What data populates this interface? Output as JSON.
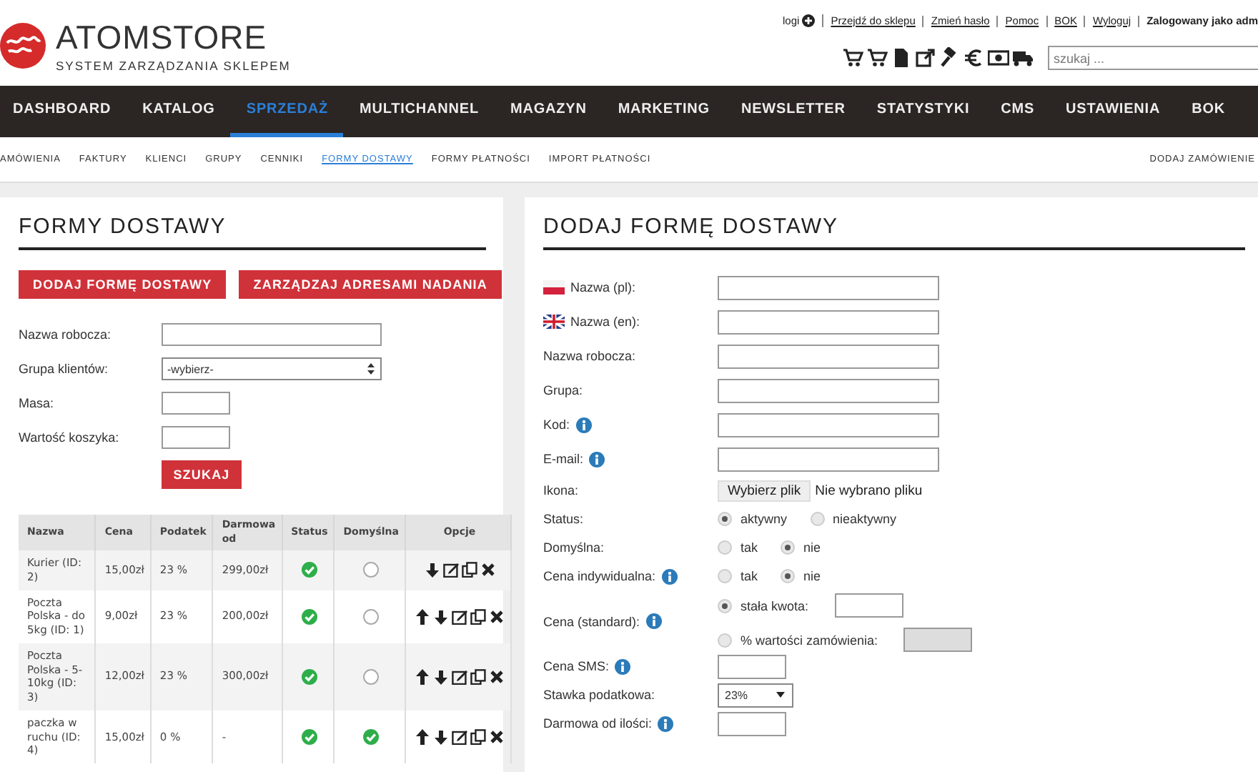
{
  "header": {
    "logo": {
      "name": "ATOMSTORE",
      "tagline": "SYSTEM ZARZĄDZANIA SKLEPEM"
    },
    "top_links": [
      {
        "label": "logi",
        "kind": "plus"
      },
      {
        "label": "Przejdź do sklepu",
        "kind": "link"
      },
      {
        "label": "Zmień hasło",
        "kind": "link"
      },
      {
        "label": "Pomoc",
        "kind": "link"
      },
      {
        "label": "BOK",
        "kind": "link"
      },
      {
        "label": "Wyloguj",
        "kind": "link"
      }
    ],
    "logged_in": "Zalogowany jako adm",
    "search": {
      "placeholder": "szukaj ..."
    }
  },
  "main_nav": [
    {
      "label": "DASHBOARD",
      "selected": false
    },
    {
      "label": "KATALOG",
      "selected": false
    },
    {
      "label": "SPRZEDAŻ",
      "selected": true
    },
    {
      "label": "MULTICHANNEL",
      "selected": false
    },
    {
      "label": "MAGAZYN",
      "selected": false
    },
    {
      "label": "MARKETING",
      "selected": false
    },
    {
      "label": "NEWSLETTER",
      "selected": false
    },
    {
      "label": "STATYSTYKI",
      "selected": false
    },
    {
      "label": "CMS",
      "selected": false
    },
    {
      "label": "USTAWIENIA",
      "selected": false
    },
    {
      "label": "BOK",
      "selected": false
    }
  ],
  "sub_nav": {
    "items": [
      {
        "label": "AMÓWIENIA",
        "selected": false
      },
      {
        "label": "FAKTURY",
        "selected": false
      },
      {
        "label": "KLIENCI",
        "selected": false
      },
      {
        "label": "GRUPY",
        "selected": false
      },
      {
        "label": "CENNIKI",
        "selected": false
      },
      {
        "label": "FORMY DOSTAWY",
        "selected": true
      },
      {
        "label": "FORMY PŁATNOŚCI",
        "selected": false
      },
      {
        "label": "IMPORT PŁATNOŚCI",
        "selected": false
      }
    ],
    "action": "DODAJ ZAMÓWIENIE"
  },
  "list_panel": {
    "title": "FORMY DOSTAWY",
    "buttons": [
      "DODAJ FORMĘ DOSTAWY",
      "ZARZĄDZAJ ADRESAMI NADANIA"
    ],
    "filters": [
      {
        "label": "Nazwa robocza:",
        "kind": "text"
      },
      {
        "label": "Grupa klientów:",
        "kind": "select",
        "value": "-wybierz-"
      },
      {
        "label": "Masa:",
        "kind": "short"
      },
      {
        "label": "Wartość koszyka:",
        "kind": "short"
      }
    ],
    "search_button": "SZUKAJ",
    "table": {
      "columns": [
        "Nazwa",
        "Cena",
        "Podatek",
        "Darmowa od",
        "Status",
        "Domyślna",
        "Opcje"
      ],
      "rows": [
        {
          "name": "Kurier (ID: 2)",
          "price": "15,00zł",
          "tax": "23 %",
          "free_from": "299,00zł",
          "status": true,
          "default": false,
          "can_move_up": false,
          "can_move_down": true
        },
        {
          "name": "Poczta Polska - do 5kg (ID: 1)",
          "price": "9,00zł",
          "tax": "23 %",
          "free_from": "200,00zł",
          "status": true,
          "default": false,
          "can_move_up": true,
          "can_move_down": true
        },
        {
          "name": "Poczta Polska - 5-10kg (ID: 3)",
          "price": "12,00zł",
          "tax": "23 %",
          "free_from": "300,00zł",
          "status": true,
          "default": false,
          "can_move_up": true,
          "can_move_down": true
        },
        {
          "name": "paczka w ruchu (ID: 4)",
          "price": "15,00zł",
          "tax": "0 %",
          "free_from": "-",
          "status": true,
          "default": true,
          "can_move_up": true,
          "can_move_down": true
        }
      ]
    }
  },
  "form_panel": {
    "title": "DODAJ FORMĘ DOSTAWY",
    "fields": [
      {
        "label": "Nazwa (pl):",
        "kind": "polish",
        "info": false
      },
      {
        "label": "Nazwa (en):",
        "kind": "english",
        "info": false
      },
      {
        "label": "Nazwa robocza:",
        "kind": "text",
        "info": false
      },
      {
        "label": "Grupa:",
        "kind": "text",
        "info": false
      },
      {
        "label": "Kod:",
        "kind": "text",
        "info": true
      },
      {
        "label": "E-mail:",
        "kind": "text",
        "info": true
      },
      {
        "label": "Ikona:",
        "kind": "file",
        "button": "Wybierz plik",
        "status": "Nie wybrano pliku",
        "info": false
      },
      {
        "label": "Status:",
        "kind": "radio",
        "info": false,
        "options": [
          {
            "label": "aktywny",
            "selected": true
          },
          {
            "label": "nieaktywny",
            "selected": false
          }
        ]
      },
      {
        "label": "Domyślna:",
        "kind": "radio",
        "info": false,
        "options": [
          {
            "label": "tak",
            "selected": false
          },
          {
            "label": "nie",
            "selected": true
          }
        ]
      },
      {
        "label": "Cena indywidualna:",
        "kind": "radio",
        "info": true,
        "options": [
          {
            "label": "tak",
            "selected": false
          },
          {
            "label": "nie",
            "selected": true
          }
        ]
      },
      {
        "label": "Cena (standard):",
        "kind": "price",
        "info": true,
        "options": [
          {
            "label": "stała kwota:",
            "selected": true,
            "disabled": false
          },
          {
            "label": "% wartości zamówienia:",
            "selected": false,
            "disabled": true
          }
        ]
      },
      {
        "label": "Cena SMS:",
        "kind": "short",
        "info": true
      },
      {
        "label": "Stawka podatkowa:",
        "kind": "select",
        "value": "23%",
        "info": false
      },
      {
        "label": "Darmowa od ilości:",
        "kind": "short",
        "info": true
      }
    ]
  }
}
